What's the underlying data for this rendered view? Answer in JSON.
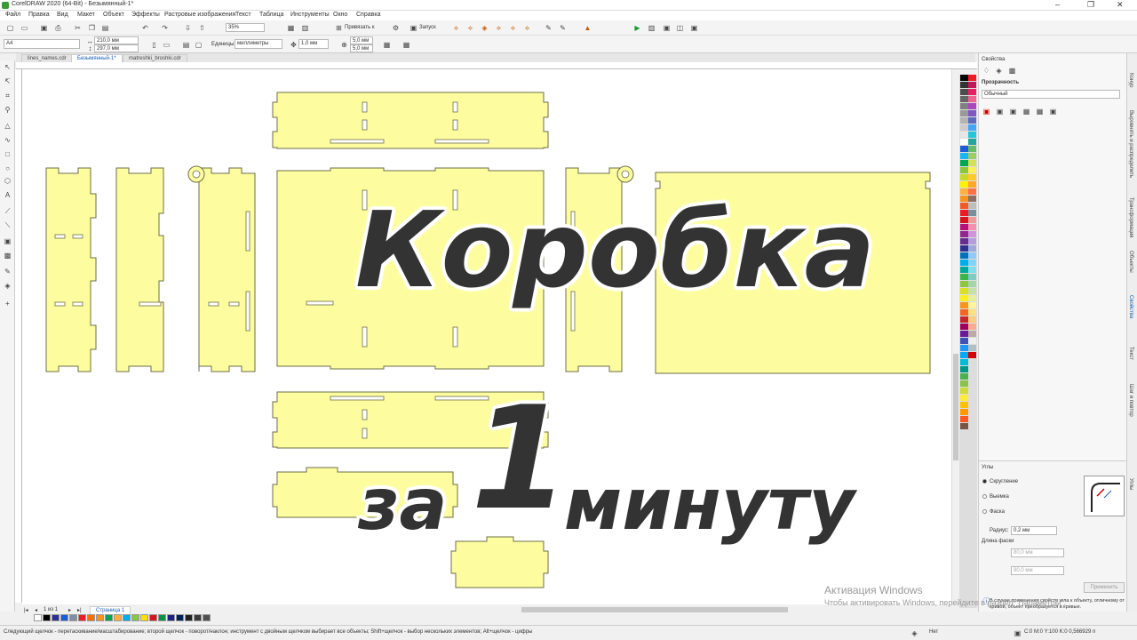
{
  "window": {
    "title": "CorelDRAW 2020 (64-Bit) - Безымянный-1*",
    "controls": [
      "–",
      "❐",
      "✕"
    ]
  },
  "menu": [
    "Файл",
    "Правка",
    "Вид",
    "Макет",
    "Объект",
    "Эффекты",
    "Растровые изображения",
    "Текст",
    "Таблица",
    "Инструменты",
    "Окно",
    "Справка"
  ],
  "toolbar": {
    "zoom": "35%",
    "snap_label": "Привязать к",
    "launch_label": "Запуск"
  },
  "property_bar": {
    "page_size": "A4",
    "width": "210,0 мм",
    "height": "297,0 мм",
    "units_label": "Единицы:",
    "units_value": "миллиметры",
    "nudge": "1,0 мм",
    "dup_x": "5,0 мм",
    "dup_y": "5,0 мм"
  },
  "doc_tabs": [
    "lines_names.cdr",
    "Безымянный-1*",
    "matreshki_broshki.cdr"
  ],
  "active_tab": 1,
  "overlay": {
    "line1": "Коробка",
    "line2a": "за",
    "line2b": "1",
    "line2c": "минуту"
  },
  "page_tab": "Страница 1",
  "docker": {
    "header": "Свойства",
    "transparency_title": "Прозрачность",
    "merge_mode": "Обычный",
    "corners_title": "Углы",
    "corner_options": [
      "Скругление",
      "Выемка",
      "Фаска"
    ],
    "selected_corner": 0,
    "radius_label": "Радиус:",
    "radius_value": "0,2 мм",
    "chamfer_label": "Длина фаски",
    "chamfer_x": "80,0 мм",
    "chamfer_y": "80,0 мм",
    "apply_button": "Применить",
    "info_text": "В случае применения свойств угла к объекту, отличному от кривой, объект преобразуется в кривые."
  },
  "docker_tabs": [
    "Конур",
    "Выровнять и распределить",
    "Трансформация",
    "Объекты",
    "Свойства",
    "Текст",
    "Шаг и повтор",
    "Углы"
  ],
  "activation": {
    "title": "Активация Windows",
    "subtitle": "Чтобы активировать Windows, перейдите в раздел \"Параметры\"."
  },
  "status": {
    "hint": "Следующий щелчок - перетаскивание/масштабирование; второй щелчок - поворот/наклон; инструмент с двойным щелчком выбирает все объекты; Shift+щелчок - выбор нескольких элементов; Alt+щелчок - цифры",
    "fill": "Нет",
    "color": "C:0 M:0 Y:100 K:0  0,566929 п"
  },
  "colors": {
    "piece_fill": "#fdfda0",
    "accent": "#1a5fb4",
    "overlay_text": "#333333"
  }
}
